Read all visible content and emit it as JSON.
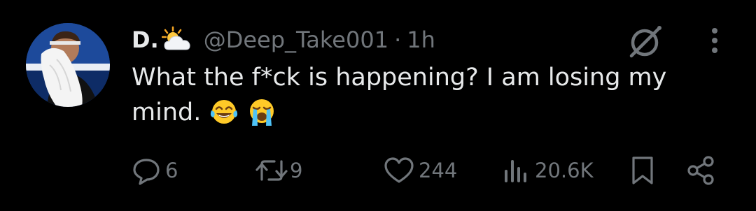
{
  "author": {
    "display_name": "D.",
    "handle": "@Deep_Take001",
    "separator": "·",
    "time": "1h",
    "name_emoji_icon": "sun-behind-cloud-icon",
    "avatar_icon": "avatar-photo"
  },
  "tweet": {
    "text_line1": "What the f*ck is happening? I am losing my",
    "text_line2": "mind.",
    "emojis": [
      "tears-of-joy-icon",
      "loudly-crying-icon"
    ]
  },
  "actions": {
    "replies": "6",
    "reposts": "9",
    "likes": "244",
    "views": "20.6K"
  },
  "colors": {
    "background": "#000000",
    "text": "#e7e9ea",
    "muted": "#71767b"
  }
}
